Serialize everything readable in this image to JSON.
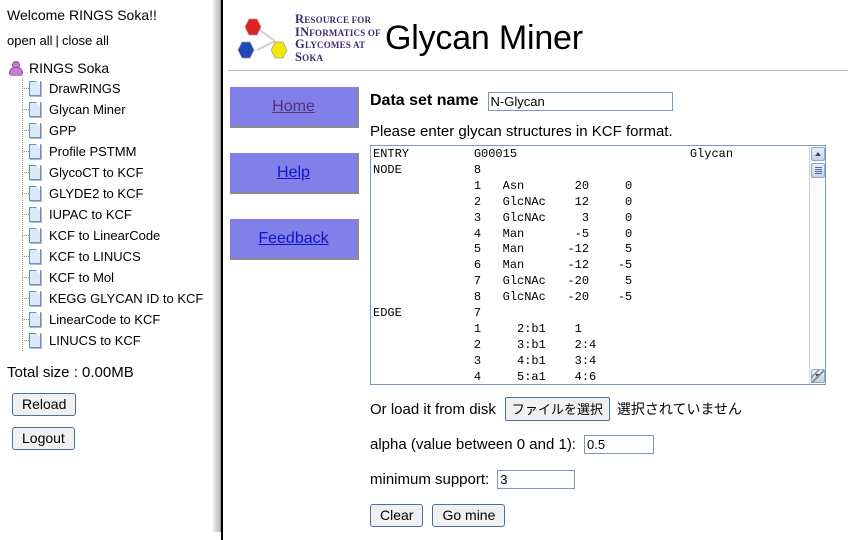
{
  "sidebar": {
    "welcome": "Welcome RINGS Soka!!",
    "open_all": "open all",
    "separator": "|",
    "close_all": "close all",
    "tree_root": "RINGS Soka",
    "tree_items": [
      "DrawRINGS",
      "Glycan Miner",
      "GPP",
      "Profile PSTMM",
      "GlycoCT to KCF",
      "GLYDE2 to KCF",
      "IUPAC to KCF",
      "KCF to LinearCode",
      "KCF to LINUCS",
      "KCF to Mol",
      "KEGG GLYCAN ID to KCF",
      "LinearCode to KCF",
      "LINUCS to KCF"
    ],
    "total_size": "Total size : 0.00MB",
    "reload_label": "Reload",
    "logout_label": "Logout"
  },
  "header": {
    "logo_lines": [
      {
        "cap": "R",
        "rest": "ESOURCE FOR"
      },
      {
        "cap": "IN",
        "rest": "FORMATICS OF"
      },
      {
        "cap": "G",
        "rest": "LYCOMES AT"
      },
      {
        "cap": "S",
        "rest": "OKA"
      }
    ],
    "title": "Glycan Miner"
  },
  "nav": {
    "home": "Home",
    "help": "Help",
    "feedback": "Feedback"
  },
  "form": {
    "dsname_label": "Data set name",
    "dsname_value": "N-Glycan",
    "dsname_placeholder": "",
    "instruction": "Please enter glycan structures in KCF format.",
    "kcf_value": "ENTRY         G00015                        Glycan\nNODE          8\n              1   Asn       20     0\n              2   GlcNAc    12     0\n              3   GlcNAc     3     0\n              4   Man       -5     0\n              5   Man      -12     5\n              6   Man      -12    -5\n              7   GlcNAc   -20     5\n              8   GlcNAc   -20    -5\nEDGE          7\n              1     2:b1    1\n              2     3:b1    2:4\n              3     4:b1    3:4\n              4     5:a1    4:6",
    "disk_label": "Or load it from disk",
    "file_button": "ファイルを選択",
    "file_status": "選択されていません",
    "alpha_label": "alpha (value between 0 and 1):",
    "alpha_value": "0.5",
    "minsup_label": "minimum support:",
    "minsup_value": "3",
    "clear_label": "Clear",
    "gomine_label": "Go mine"
  }
}
